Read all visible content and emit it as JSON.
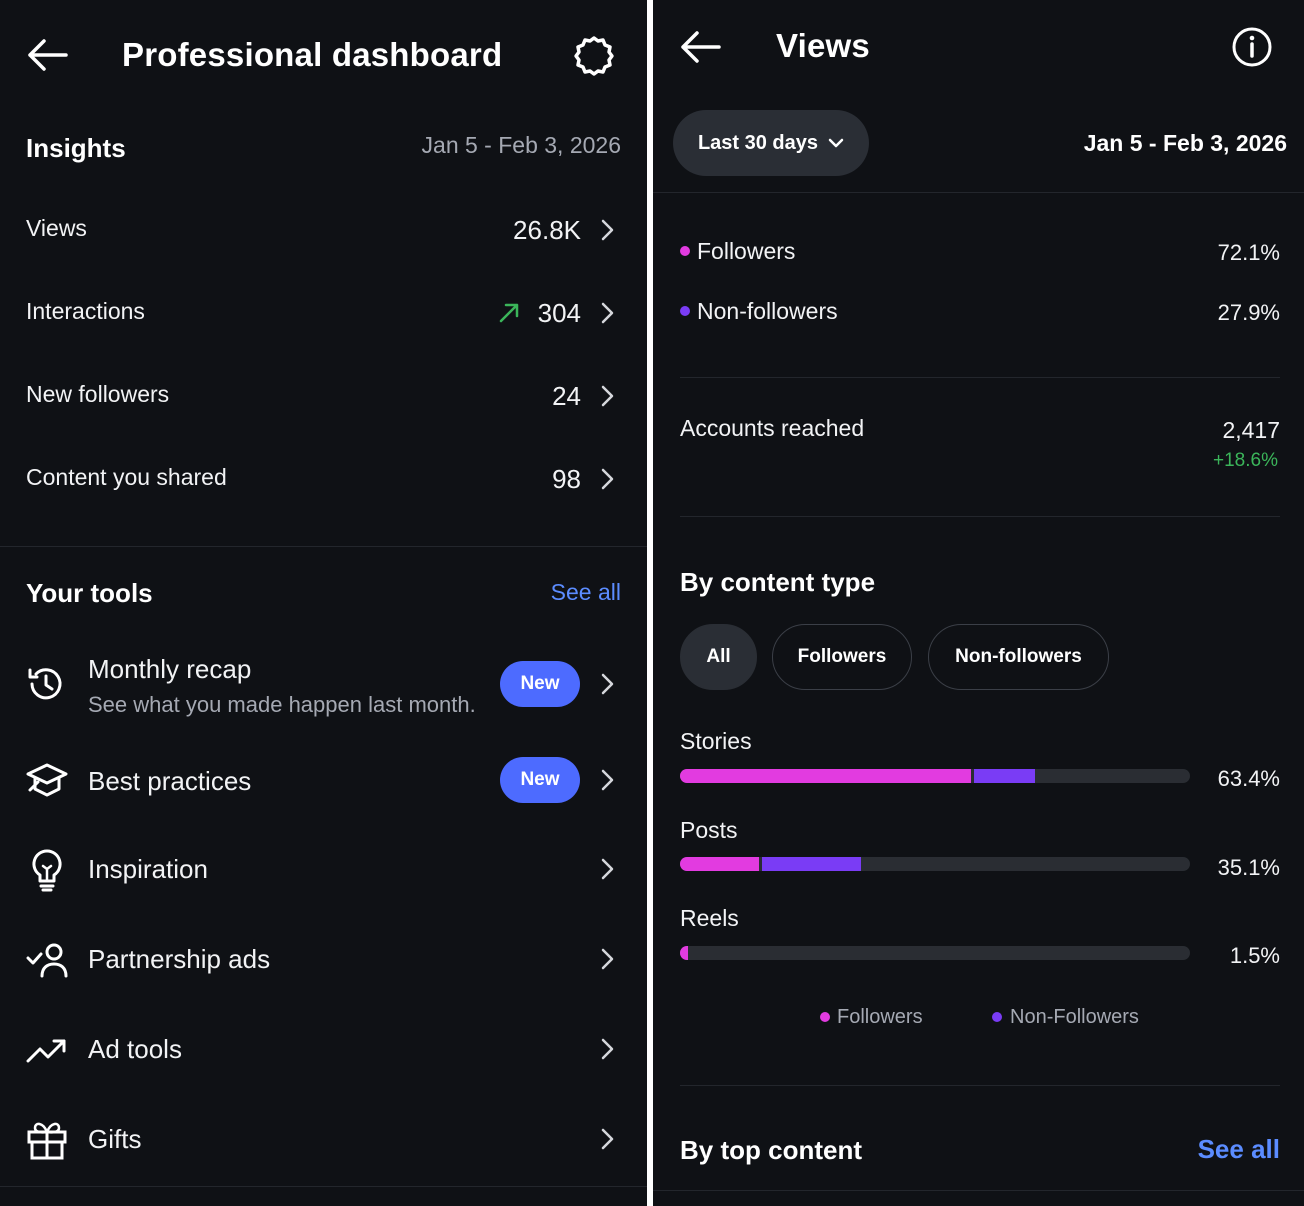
{
  "colors": {
    "followers": "#e23be0",
    "non_followers": "#7a3cf5",
    "link": "#5b8cff",
    "badge": "#4d6bff",
    "growth": "#3bb55a"
  },
  "dashboard": {
    "title": "Professional dashboard",
    "insights": {
      "title": "Insights",
      "date_range": "Jan 5 - Feb 3, 2026",
      "rows": [
        {
          "label": "Views",
          "value": "26.8K"
        },
        {
          "label": "Interactions",
          "value": "304",
          "trend_icon": "trend-up-arrow-icon"
        },
        {
          "label": "New followers",
          "value": "24"
        },
        {
          "label": "Content you shared",
          "value": "98"
        }
      ]
    },
    "tools": {
      "title": "Your tools",
      "see_all": "See all",
      "items": [
        {
          "label": "Monthly recap",
          "subtitle": "See what you made happen last month.",
          "badge": "New",
          "icon": "history-icon"
        },
        {
          "label": "Best practices",
          "badge": "New",
          "icon": "graduation-cap-icon"
        },
        {
          "label": "Inspiration",
          "icon": "lightbulb-icon"
        },
        {
          "label": "Partnership ads",
          "icon": "partnership-person-icon"
        },
        {
          "label": "Ad tools",
          "icon": "trending-line-icon"
        },
        {
          "label": "Gifts",
          "icon": "gift-icon"
        }
      ]
    }
  },
  "views": {
    "title": "Views",
    "range_button": "Last 30 days",
    "date_range": "Jan 5 - Feb 3, 2026",
    "audience": [
      {
        "label": "Followers",
        "value": "72.1%"
      },
      {
        "label": "Non-followers",
        "value": "27.9%"
      }
    ],
    "accounts_reached": {
      "label": "Accounts reached",
      "value": "2,417",
      "change": "+18.6%"
    },
    "by_content_type": {
      "title": "By content type",
      "filters": [
        "All",
        "Followers",
        "Non-followers"
      ],
      "active_filter": "All",
      "rows": [
        {
          "label": "Stories",
          "value": "63.4%",
          "followers_fraction": 0.57,
          "non_followers_fraction": 0.12
        },
        {
          "label": "Posts",
          "value": "35.1%",
          "followers_fraction": 0.155,
          "non_followers_fraction": 0.195
        },
        {
          "label": "Reels",
          "value": "1.5%",
          "followers_fraction": 0.015,
          "non_followers_fraction": 0.0
        }
      ],
      "legend": [
        "Followers",
        "Non-Followers"
      ]
    },
    "by_top_content": {
      "title": "By top content",
      "see_all": "See all"
    }
  }
}
